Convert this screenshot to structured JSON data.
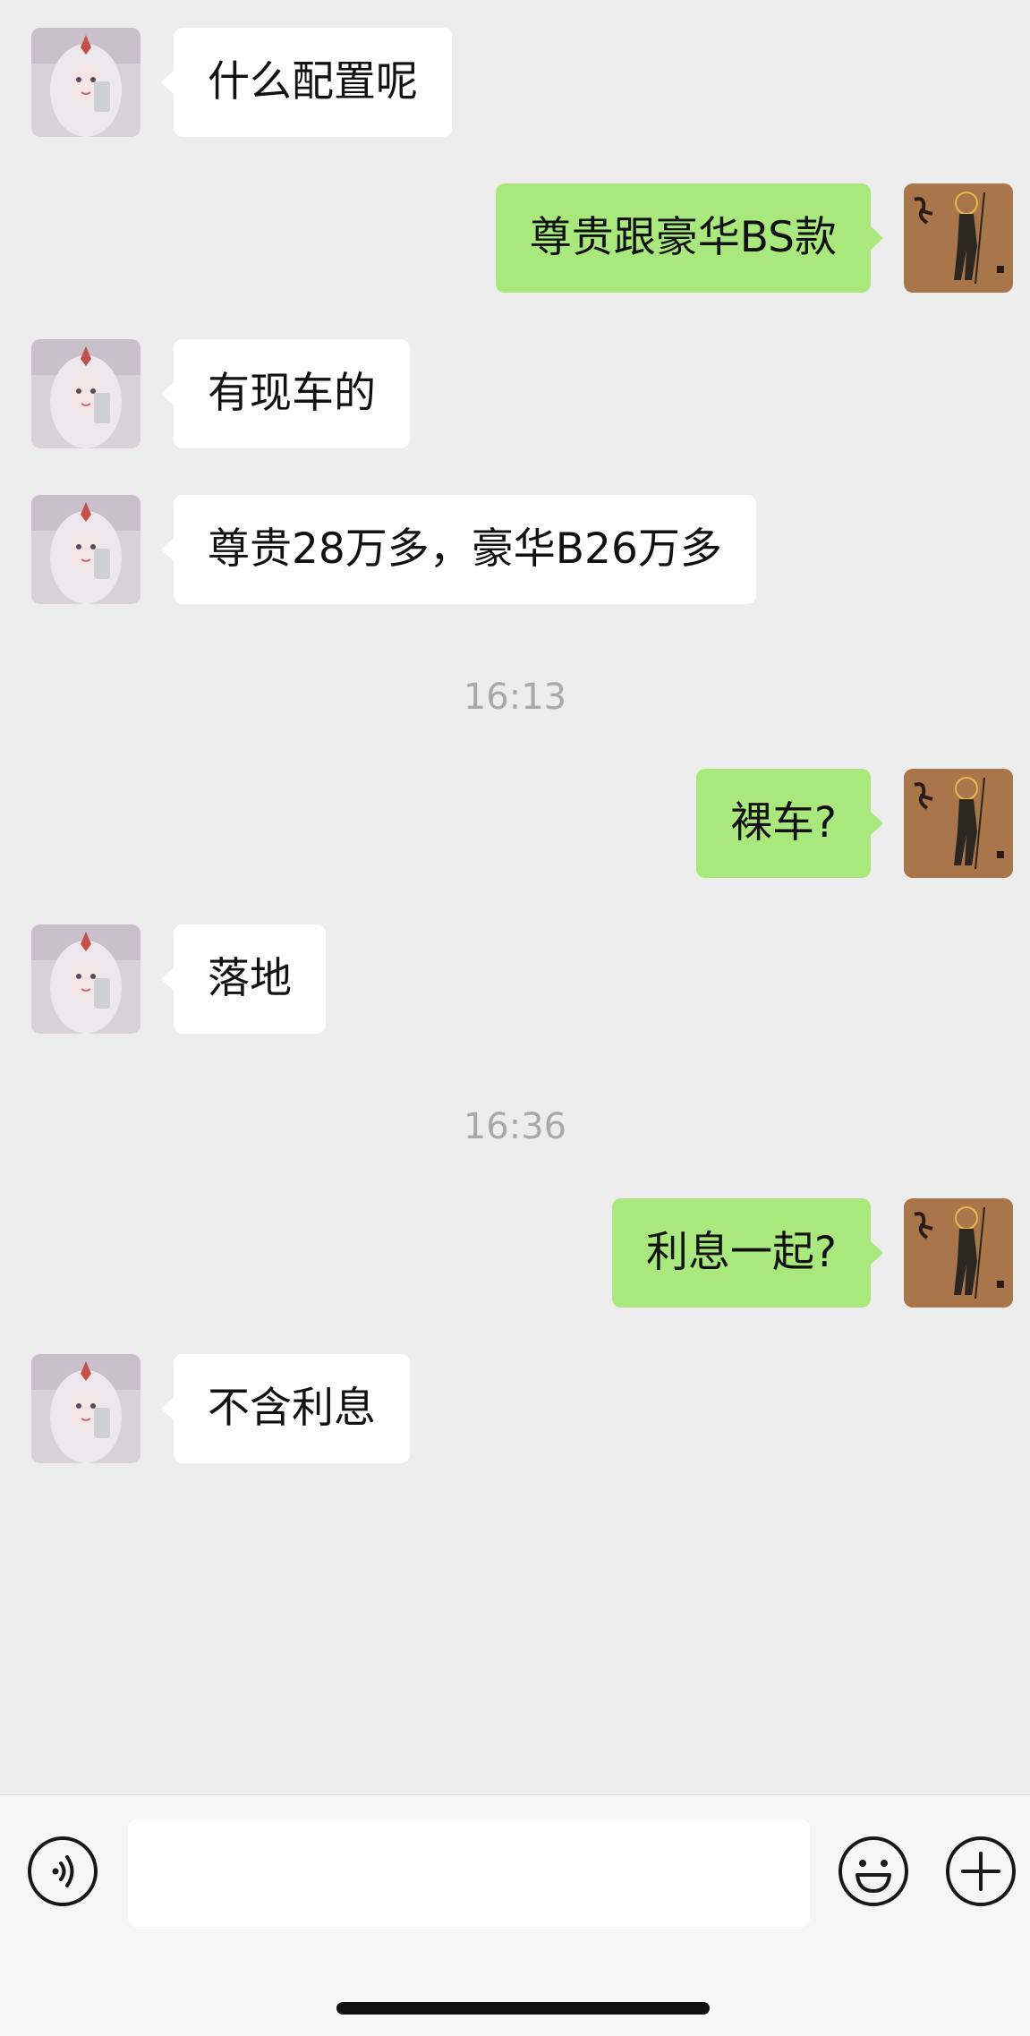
{
  "messages": [
    {
      "side": "left",
      "text": "什么配置呢"
    },
    {
      "side": "right",
      "text": "尊贵跟豪华BS款"
    },
    {
      "side": "left",
      "text": "有现车的"
    },
    {
      "side": "left",
      "text": "尊贵28万多，豪华B26万多"
    },
    {
      "timestamp": "16:13"
    },
    {
      "side": "right",
      "text": "裸车?"
    },
    {
      "side": "left",
      "text": "落地"
    },
    {
      "timestamp": "16:36"
    },
    {
      "side": "right",
      "text": "利息一起?"
    },
    {
      "side": "left",
      "text": "不含利息"
    }
  ],
  "toolbar": {
    "input_placeholder": "",
    "icons": [
      "voice-icon",
      "emoji-icon",
      "plus-icon"
    ]
  },
  "colors": {
    "background": "#ededed",
    "bubble_left": "#ffffff",
    "bubble_right": "#a9e87c",
    "timestamp": "#a9a9a9",
    "toolbar": "#f6f6f6"
  }
}
